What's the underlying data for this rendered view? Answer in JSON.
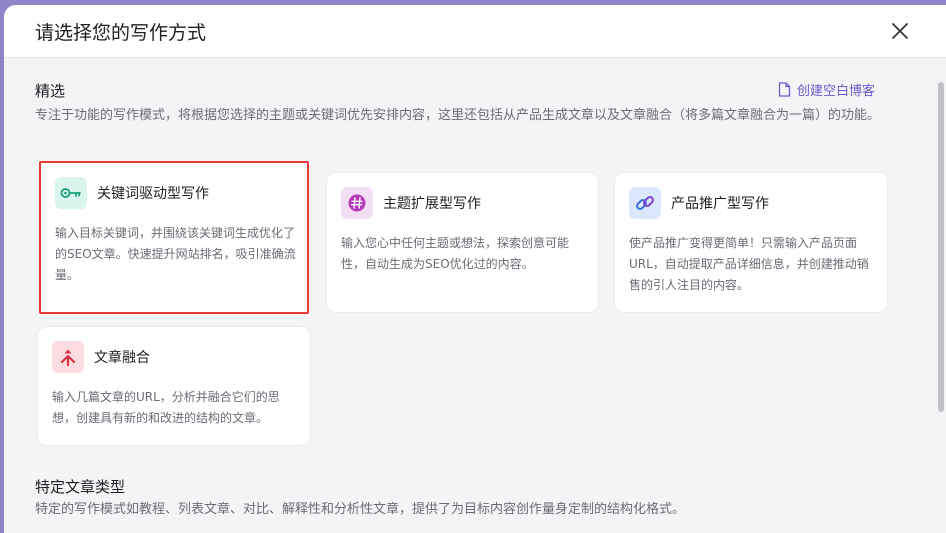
{
  "modal": {
    "title": "请选择您的写作方式"
  },
  "featured": {
    "title": "精选",
    "description": "专注于功能的写作模式，将根据您选择的主题或关键词优先安排内容，这里还包括从产品生成文章以及文章融合（将多篇文章融合为一篇）的功能。",
    "create_blank_label": "创建空白博客"
  },
  "cards": [
    {
      "title": "关键词驱动型写作",
      "description": "输入目标关键词，并围绕该关键词生成优化了的SEO文章。快速提升网站排名，吸引准确流量。",
      "icon": "key-icon",
      "icon_bg": "#d9f5ee",
      "icon_color": "#1e9e7a"
    },
    {
      "title": "主题扩展型写作",
      "description": "输入您心中任何主题或想法，探索创意可能性，自动生成为SEO优化过的内容。",
      "icon": "hashtag-icon",
      "icon_bg": "#f6ddf6",
      "icon_color": "#b23ab8"
    },
    {
      "title": "产品推广型写作",
      "description": "使产品推广变得更简单！只需输入产品页面URL，自动提取产品详细信息，并创建推动销售的引人注目的内容。",
      "icon": "link-icon",
      "icon_bg": "#dbe8fb",
      "icon_color": "#3b6fd8"
    },
    {
      "title": "文章融合",
      "description": "输入几篇文章的URL，分析并融合它们的思想，创建具有新的和改进的结构的文章。",
      "icon": "merge-icon",
      "icon_bg": "#fbdce0",
      "icon_color": "#d63447"
    }
  ],
  "specific": {
    "title": "特定文章类型",
    "description": "特定的写作模式如教程、列表文章、对比、解释性和分析性文章，提供了为目标内容创作量身定制的结构化格式。"
  },
  "colors": {
    "accent": "#6a5acd",
    "selection": "#e53935"
  }
}
